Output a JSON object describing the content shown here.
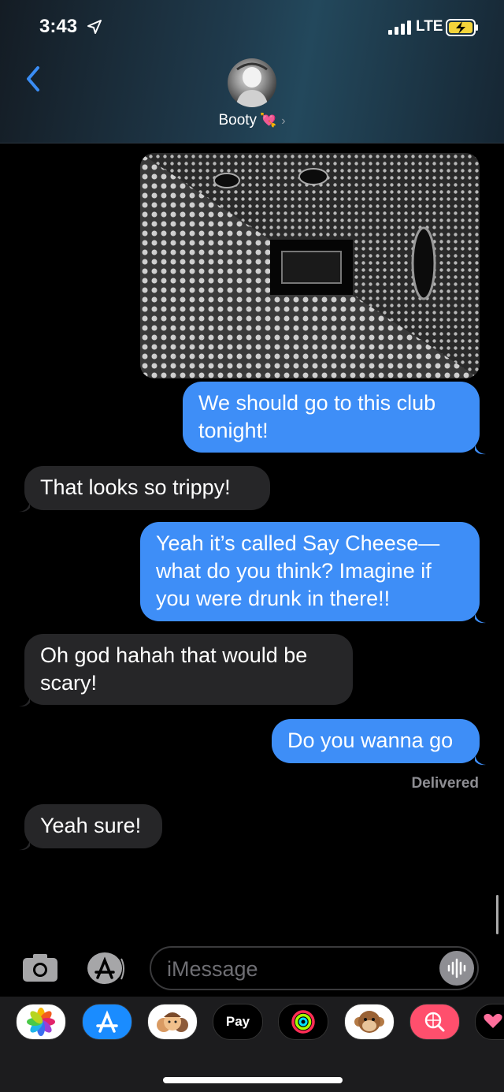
{
  "status_bar": {
    "time": "3:43",
    "network": "LTE"
  },
  "header": {
    "contact_name": "Booty"
  },
  "messages": [
    {
      "side": "sent",
      "text": "We should go to this club tonight!"
    },
    {
      "side": "received",
      "text": "That looks so trippy!"
    },
    {
      "side": "sent",
      "text": "Yeah it’s called Say Cheese—what do you think? Imagine if you were drunk in there!!"
    },
    {
      "side": "received",
      "text": "Oh god hahah that would be scary!"
    },
    {
      "side": "sent",
      "text": "Do you wanna go"
    },
    {
      "side": "received",
      "text": "Yeah sure!"
    }
  ],
  "delivered_label": "Delivered",
  "composer": {
    "placeholder": "iMessage"
  },
  "app_tray": {
    "pay_label": "Pay"
  },
  "colors": {
    "sent_bubble": "#3e8ef7",
    "received_bubble": "#262628",
    "back_chevron": "#3a8df5"
  }
}
